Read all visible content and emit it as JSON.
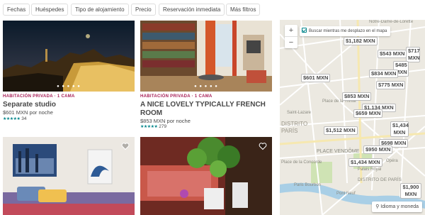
{
  "filters": [
    "Fechas",
    "Huéspedes",
    "Tipo de alojamiento",
    "Precio",
    "Reservación inmediata",
    "Más filtros"
  ],
  "listings": [
    {
      "type": "HABITACIÓN PRIVADA · 1 CAMA",
      "title": "Separate studio",
      "price": "$601 MXN por noche",
      "rating_stars": "★★★★★",
      "reviews": "34"
    },
    {
      "type": "HABITACIÓN PRIVADA · 1 CAMA",
      "title": "A NICE LOVELY TYPICALLY FRENCH ROOM",
      "price": "$853 MXN por noche",
      "rating_stars": "★★★★★",
      "reviews": "279"
    }
  ],
  "map": {
    "search_as_move": "Buscar mientras me desplazo en el mapa",
    "zoom_in": "+",
    "zoom_out": "−",
    "language_button": "Idioma y moneda",
    "markers": [
      "$1,182 MXN",
      "$543 MXN",
      "$717 MXN",
      "$485 MXN",
      "$601 MXN",
      "$834 MXN",
      "$775 MXN",
      "$853 MXN",
      "$1,134 MXN",
      "$659 MXN",
      "$1,434 MXN",
      "$1,512 MXN",
      "$698 MXN",
      "$950 MXN",
      "$1,434 MXN",
      "$1,900 MXN"
    ],
    "labels": [
      "Notre-Dame-de-Lorette",
      "Place de la Trinité",
      "Saint-Lazare",
      "Opéra",
      "DISTRITO",
      "PARÍS",
      "PLACE VENDÔME",
      "DISTRITO DE PARÍS",
      "Place de la Concorde",
      "Paris Bourbon",
      "Palais Royal",
      "Pont Neuf"
    ]
  },
  "colors": {
    "accent": "#008489",
    "type_label": "#a61d55",
    "map_bg": "#ece9e1"
  }
}
